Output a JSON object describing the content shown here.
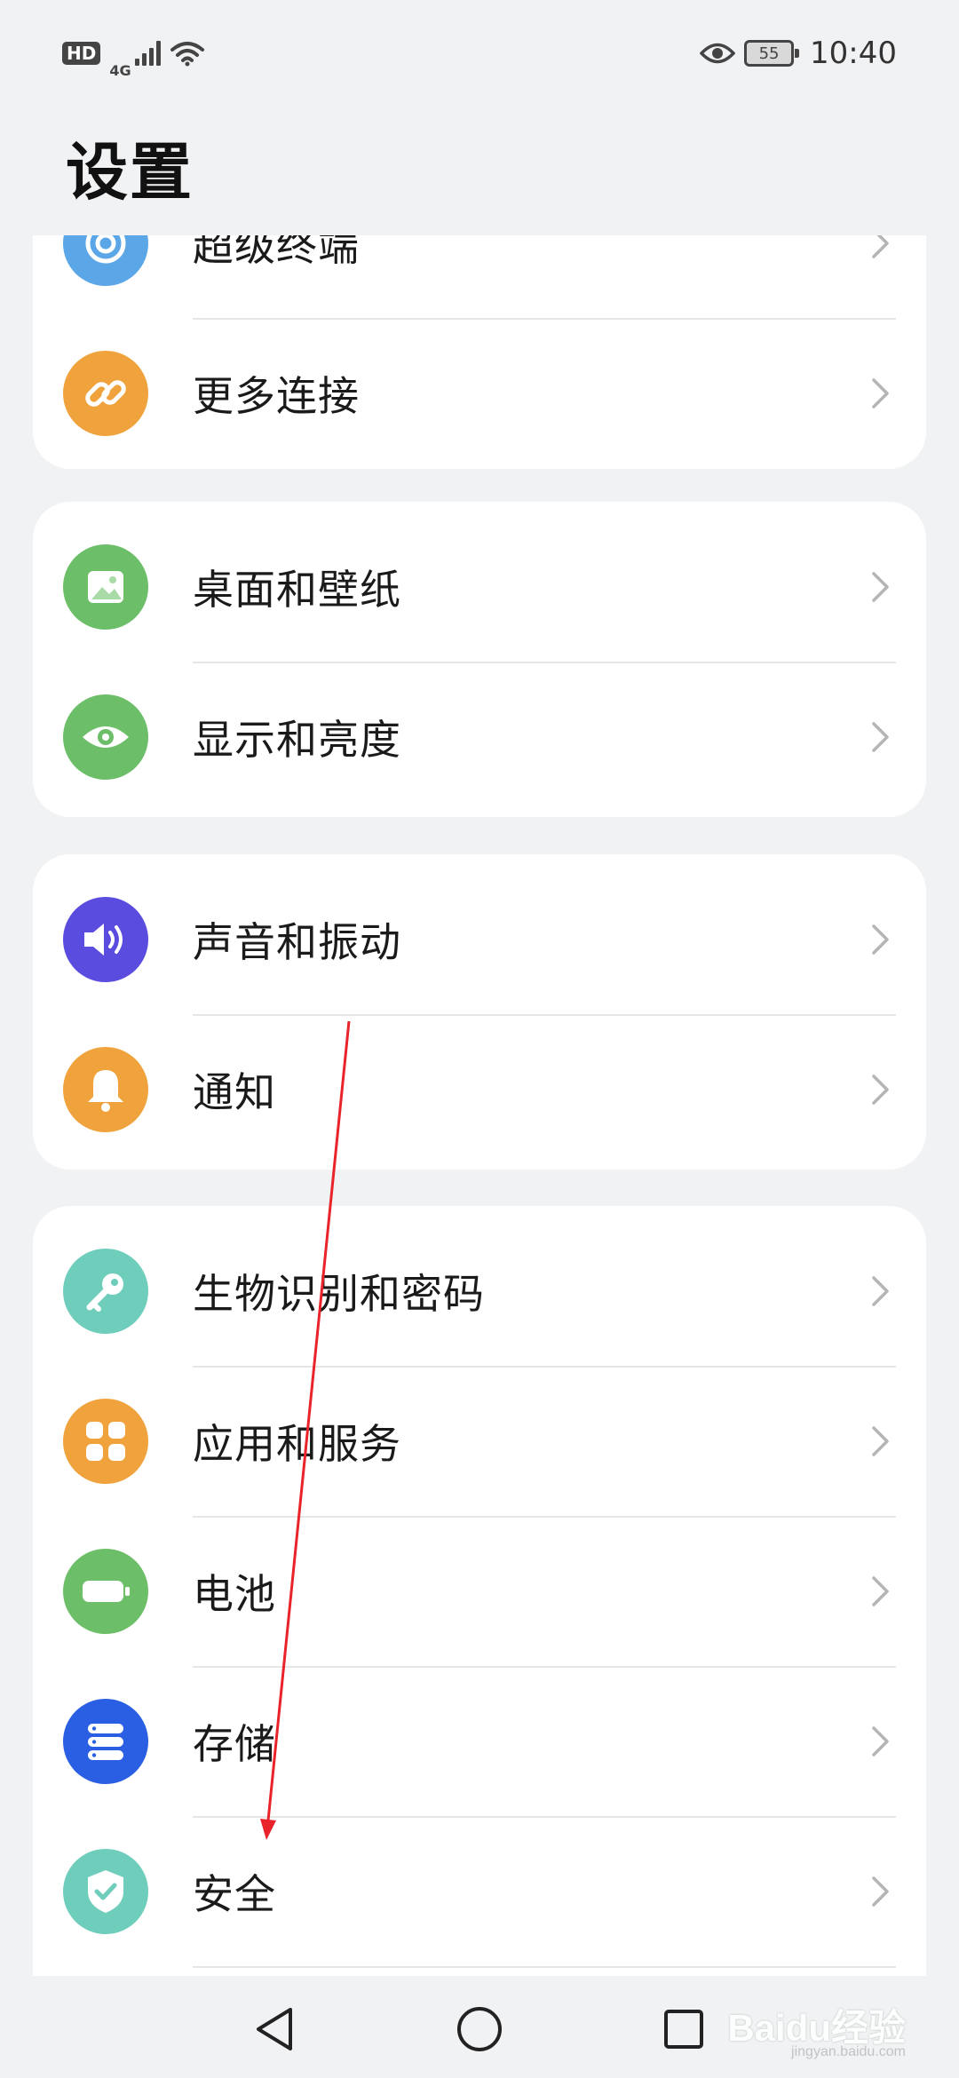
{
  "status_bar": {
    "hd": "HD",
    "network": "4G",
    "battery": "55",
    "time": "10:40"
  },
  "title": "设置",
  "groups": [
    {
      "items": [
        {
          "label": "超级终端",
          "icon": "super-device-icon",
          "color": "#5aa6e6"
        },
        {
          "label": "更多连接",
          "icon": "link-icon",
          "color": "#f0a33c"
        }
      ]
    },
    {
      "items": [
        {
          "label": "桌面和壁纸",
          "icon": "wallpaper-icon",
          "color": "#6cbf68"
        },
        {
          "label": "显示和亮度",
          "icon": "eye-icon",
          "color": "#6cbf68"
        }
      ]
    },
    {
      "items": [
        {
          "label": "声音和振动",
          "icon": "speaker-icon",
          "color": "#5b4ce0"
        },
        {
          "label": "通知",
          "icon": "bell-icon",
          "color": "#f0a33c"
        }
      ]
    },
    {
      "items": [
        {
          "label": "生物识别和密码",
          "icon": "key-icon",
          "color": "#6fcdbc"
        },
        {
          "label": "应用和服务",
          "icon": "apps-icon",
          "color": "#f0a33c"
        },
        {
          "label": "电池",
          "icon": "battery-icon",
          "color": "#6cbf68"
        },
        {
          "label": "存储",
          "icon": "storage-icon",
          "color": "#2b5fe3"
        },
        {
          "label": "安全",
          "icon": "shield-icon",
          "color": "#6fcdbc"
        }
      ]
    }
  ],
  "watermark": {
    "text": "Baidu经验",
    "sub": "jingyan.baidu.com"
  },
  "colors": {
    "background": "#f1f2f4",
    "card": "#ffffff",
    "annotation_arrow": "#e8232a"
  }
}
